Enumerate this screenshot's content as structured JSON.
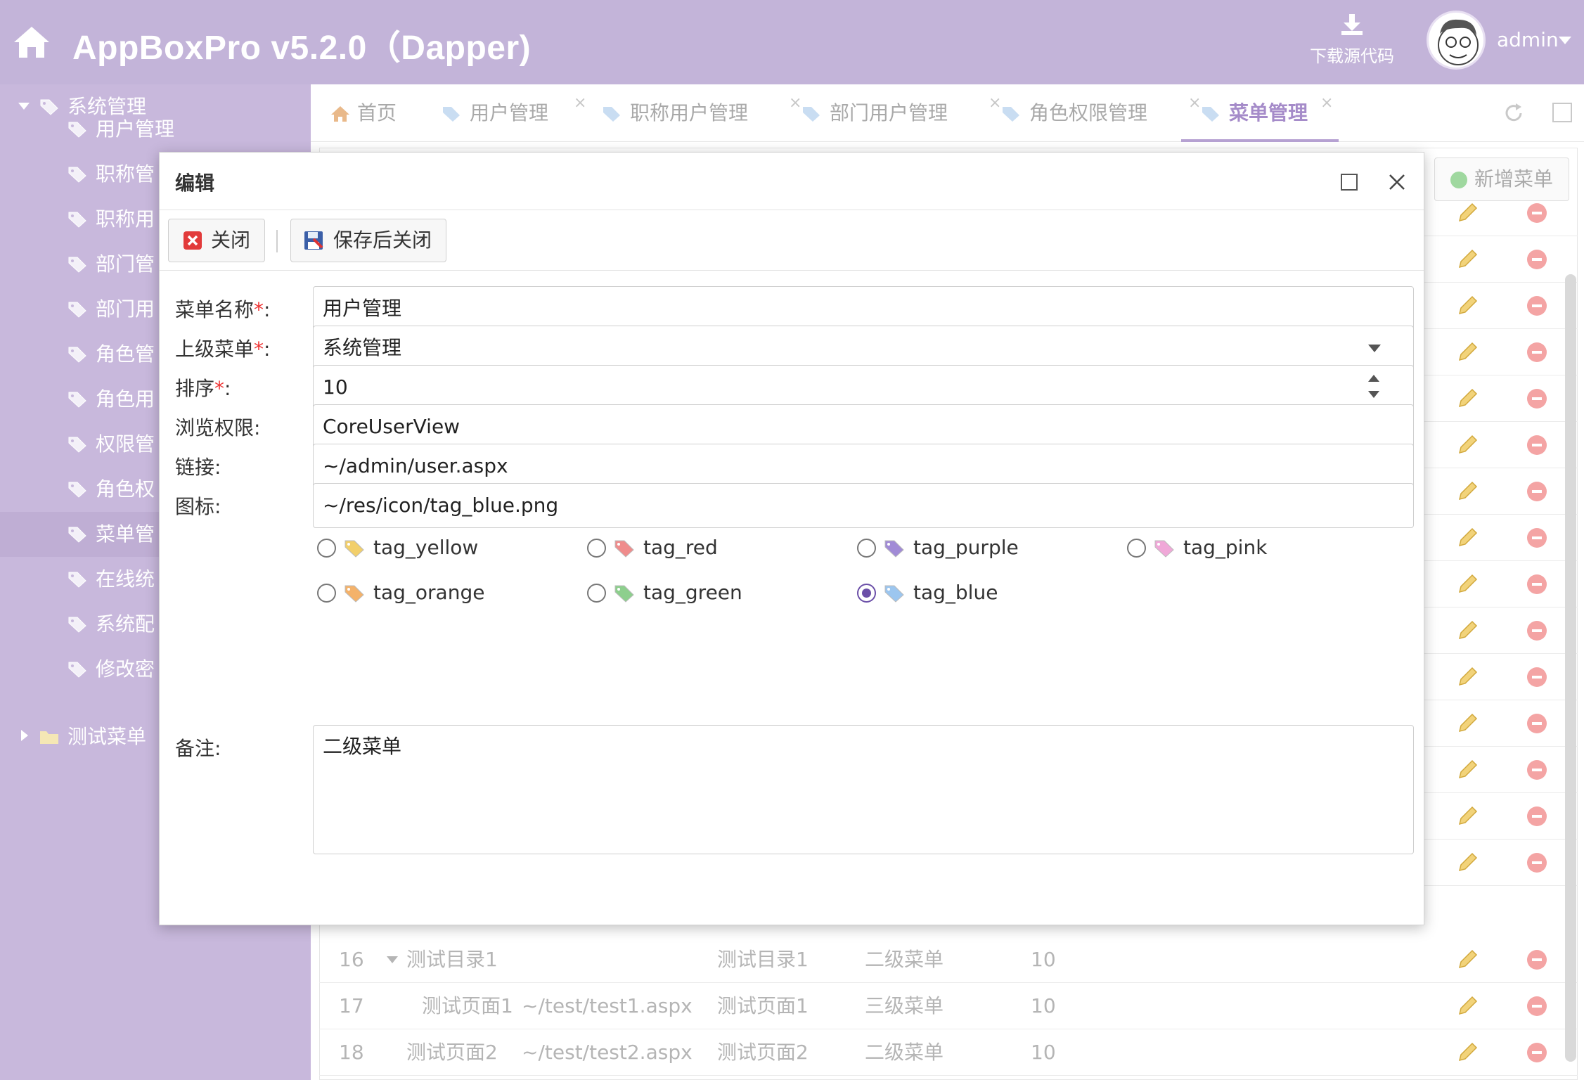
{
  "header": {
    "app_title": "AppBoxPro v5.2.0（Dapper)",
    "download_label": "下载源代码",
    "user_name": "admin"
  },
  "sidebar": {
    "group1": "系统管理",
    "items": [
      "用户管理",
      "职称管",
      "职称用",
      "部门管",
      "部门用",
      "角色管",
      "角色用",
      "权限管",
      "角色权",
      "菜单管",
      "在线统",
      "系统配",
      "修改密"
    ],
    "active_index": 9,
    "group2": "测试菜单"
  },
  "tabs": [
    {
      "label": "首页",
      "icon": "home-icon"
    },
    {
      "label": "用户管理",
      "icon": "tag-icon"
    },
    {
      "label": "职称用户管理",
      "icon": "tag-icon"
    },
    {
      "label": "部门用户管理",
      "icon": "tag-icon"
    },
    {
      "label": "角色权限管理",
      "icon": "tag-icon"
    },
    {
      "label": "菜单管理",
      "icon": "tag-icon",
      "active": true
    }
  ],
  "grid": {
    "add_button": "新增菜单",
    "rows": [
      {
        "no": "16",
        "name": "测试目录1",
        "url": "",
        "title": "测试目录1",
        "remark": "二级菜单",
        "sort": "10"
      },
      {
        "no": "17",
        "name": "测试页面1",
        "url": "~/test/test1.aspx",
        "title": "测试页面1",
        "remark": "三级菜单",
        "sort": "10"
      },
      {
        "no": "18",
        "name": "测试页面2",
        "url": "~/test/test2.aspx",
        "title": "测试页面2",
        "remark": "二级菜单",
        "sort": "10"
      }
    ]
  },
  "dialog": {
    "title": "编辑",
    "close_button": "关闭",
    "save_close_button": "保存后关闭",
    "fields": {
      "name_label": "菜单名称",
      "name_value": "用户管理",
      "parent_label": "上级菜单",
      "parent_value": "系统管理",
      "sort_label": "排序",
      "sort_value": "10",
      "view_power_label": "浏览权限:",
      "view_power_value": "CoreUserView",
      "link_label": "链接:",
      "link_value": "~/admin/user.aspx",
      "icon_label": "图标:",
      "icon_value": "~/res/icon/tag_blue.png",
      "remark_label": "备注:",
      "remark_value": "二级菜单"
    },
    "icon_options": [
      {
        "label": "tag_yellow",
        "color": "#f2cf6b",
        "selected": false
      },
      {
        "label": "tag_red",
        "color": "#ef8c8c",
        "selected": false
      },
      {
        "label": "tag_purple",
        "color": "#a18bd6",
        "selected": false
      },
      {
        "label": "tag_pink",
        "color": "#f0a8d8",
        "selected": false
      },
      {
        "label": "tag_orange",
        "color": "#f4b26a",
        "selected": false
      },
      {
        "label": "tag_green",
        "color": "#8dcf8d",
        "selected": false
      },
      {
        "label": "tag_blue",
        "color": "#9cc6ef",
        "selected": true
      }
    ]
  },
  "colors": {
    "header_bg": "#c3b4d9",
    "sidebar_bg": "#c8b8dc",
    "accent": "#a58bc9",
    "required": "#ee3333"
  }
}
